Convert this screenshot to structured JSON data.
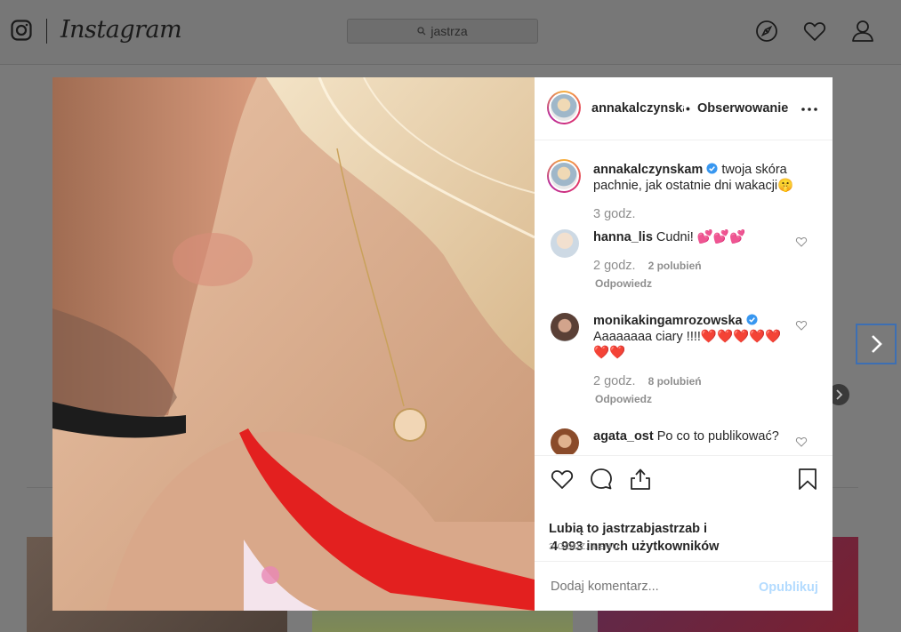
{
  "header": {
    "wordmark": "Instagram",
    "search_value": "jastrza"
  },
  "post": {
    "username": "annakalczynskam",
    "username_truncated": "annakalczynska",
    "separator": "•",
    "follow_label": "Obserwowanie",
    "caption_user": "annakalczynskam",
    "caption_text": "twoja skóra pachnie, jak ostatnie dni wakacji🤫",
    "caption_time": "3 godz.",
    "comments": [
      {
        "user": "hanna_lis",
        "text": "Cudni! 💕💕💕",
        "time": "2 godz.",
        "likes": "2 polubień",
        "reply": "Odpowiedz"
      },
      {
        "user": "monikakingamrozowska",
        "text": "Aaaaaaaa ciary !!!!❤️❤️❤️❤️❤️❤️❤️",
        "time": "2 godz.",
        "likes": "8 polubień",
        "reply": "Odpowiedz"
      },
      {
        "user": "agata_ost",
        "text": "Po co to publikować?"
      }
    ],
    "likes_line1": "Lubią to jastrzabjastrzab i",
    "likes_line2": "4 993 innych użytkowników",
    "timestamp": "3 GODZ. TEMU",
    "add_comment_placeholder": "Dodaj komentarz...",
    "publish_label": "Opublikuj"
  },
  "colors": {
    "overlay": "#7a7a7a",
    "verified": "#3897f0",
    "publish_disabled": "#b3dbff",
    "meta_gray": "#8e8e8e"
  }
}
